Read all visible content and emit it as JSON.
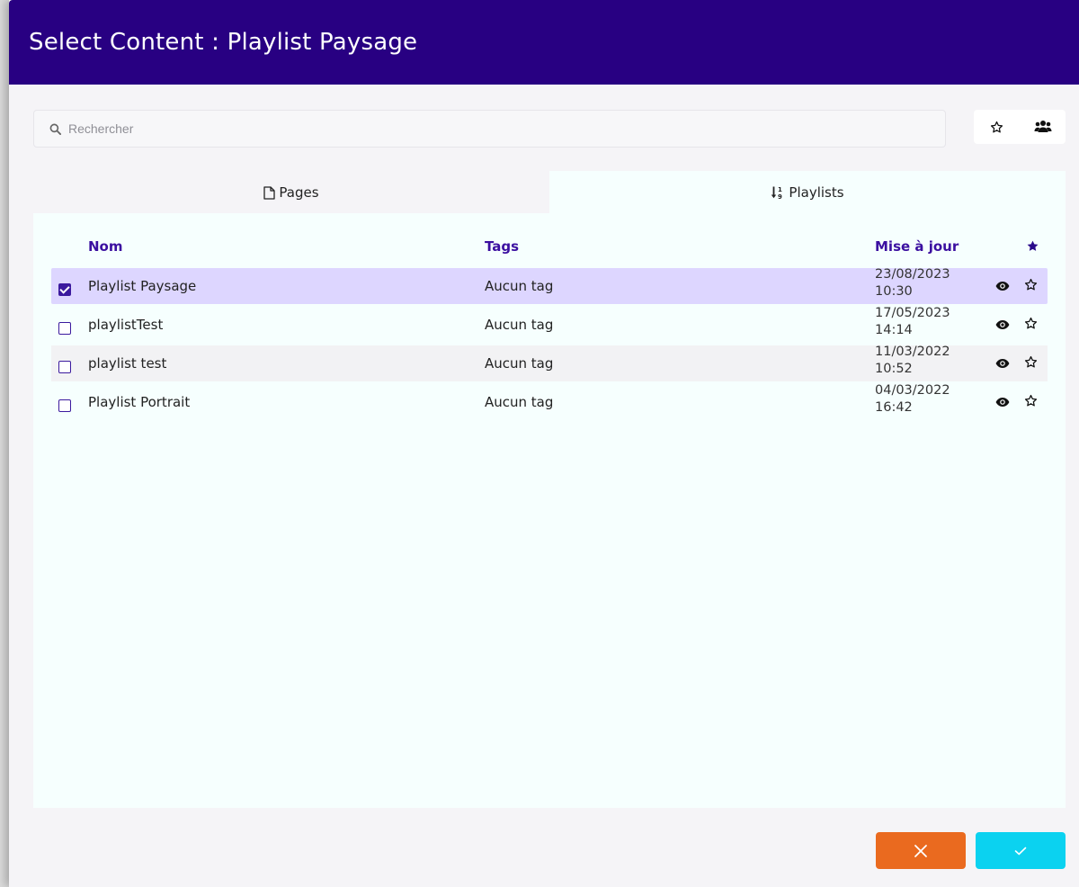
{
  "dialog": {
    "title": "Select Content : Playlist Paysage"
  },
  "search": {
    "placeholder": "Rechercher",
    "value": ""
  },
  "filters": {
    "favorites_icon": "star-outline-icon",
    "groups_icon": "users-icon"
  },
  "tabs": [
    {
      "label": "Pages",
      "icon": "file-icon",
      "active": false
    },
    {
      "label": "Playlists",
      "icon": "sort-numeric-icon",
      "active": true
    }
  ],
  "table": {
    "columns": {
      "name": "Nom",
      "tags": "Tags",
      "updated": "Mise à jour",
      "favorite_icon": "star-filled-icon"
    },
    "rows": [
      {
        "name": "Playlist Paysage",
        "tags": "Aucun tag",
        "date": "23/08/2023",
        "time": "10:30",
        "checked": true
      },
      {
        "name": "playlistTest",
        "tags": "Aucun tag",
        "date": "17/05/2023",
        "time": "14:14",
        "checked": false
      },
      {
        "name": "playlist test",
        "tags": "Aucun tag",
        "date": "11/03/2022",
        "time": "10:52",
        "checked": false
      },
      {
        "name": "Playlist Portrait",
        "tags": "Aucun tag",
        "date": "04/03/2022",
        "time": "16:42",
        "checked": false
      }
    ]
  },
  "footer": {
    "cancel_icon": "close-icon",
    "confirm_icon": "check-icon"
  },
  "colors": {
    "header": "#280082",
    "accent": "#3b0fa0",
    "selected_row": "#ddd6ff",
    "cancel": "#ea6a1f",
    "confirm": "#0bd2f0"
  }
}
